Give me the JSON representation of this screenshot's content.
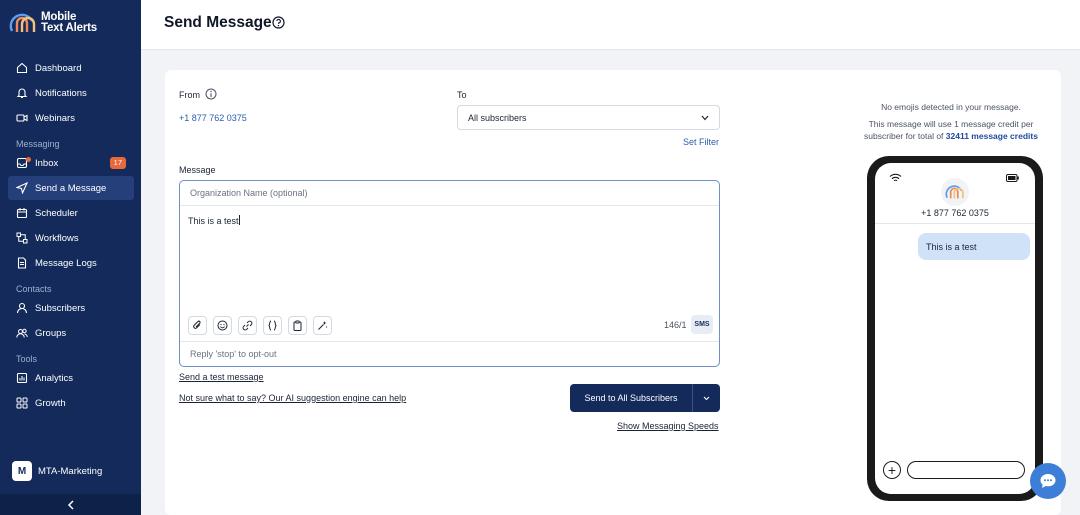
{
  "app": {
    "logo_line1": "Mobile",
    "logo_line2": "Text Alerts"
  },
  "sidebar": {
    "items": [
      {
        "label": "Dashboard",
        "icon": "home-icon"
      },
      {
        "label": "Notifications",
        "icon": "bell-icon"
      },
      {
        "label": "Webinars",
        "icon": "video-icon"
      }
    ],
    "messaging_section": "Messaging",
    "messaging": [
      {
        "label": "Inbox",
        "icon": "inbox-icon",
        "badge": "17"
      },
      {
        "label": "Send a Message",
        "icon": "send-icon",
        "active": true
      },
      {
        "label": "Scheduler",
        "icon": "calendar-icon"
      },
      {
        "label": "Workflows",
        "icon": "workflow-icon"
      },
      {
        "label": "Message Logs",
        "icon": "document-icon"
      }
    ],
    "contacts_section": "Contacts",
    "contacts": [
      {
        "label": "Subscribers",
        "icon": "user-icon"
      },
      {
        "label": "Groups",
        "icon": "group-icon"
      }
    ],
    "tools_section": "Tools",
    "tools": [
      {
        "label": "Analytics",
        "icon": "chart-icon"
      },
      {
        "label": "Growth",
        "icon": "grid-icon"
      }
    ],
    "account": {
      "initial": "M",
      "name": "MTA-Marketing"
    }
  },
  "header": {
    "title": "Send Message"
  },
  "form": {
    "from_label": "From",
    "from_number": "+1 877 762 0375",
    "to_label": "To",
    "to_value": "All subscribers",
    "set_filter": "Set Filter",
    "message_label": "Message",
    "org_placeholder": "Organization Name (optional)",
    "message_text": "This is a test",
    "counter": "146/1",
    "sms_tag": "SMS",
    "optout": "Reply 'stop' to opt-out",
    "test_link": "Send a test message",
    "ai_link": "Not sure what to say? Our AI suggestion engine can help",
    "send_button": "Send to All Subscribers",
    "speeds_link": "Show Messaging Speeds"
  },
  "preview": {
    "emoji_note": "No emojis detected in your message.",
    "credit_note_prefix": "This message will use 1 message credit per subscriber for total of ",
    "credit_total": "32411 message credits",
    "phone_number": "+1 877 762 0375",
    "bubble_text": "This is a test"
  },
  "colors": {
    "sidebar": "#132a5a",
    "accent": "#2a5db0",
    "badge": "#e8683b",
    "bubble": "#cfe2f7"
  }
}
